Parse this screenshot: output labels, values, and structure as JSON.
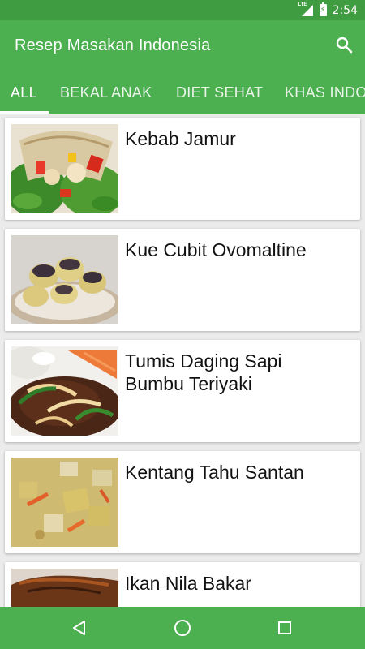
{
  "status_bar": {
    "time": "2:54",
    "network": "LTE"
  },
  "app_bar": {
    "title": "Resep Masakan Indonesia"
  },
  "tabs": [
    {
      "label": "ALL"
    },
    {
      "label": "BEKAL ANAK"
    },
    {
      "label": "DIET SEHAT"
    },
    {
      "label": "KHAS INDO"
    }
  ],
  "recipes": [
    {
      "title": "Kebab Jamur"
    },
    {
      "title": "Kue Cubit Ovomaltine"
    },
    {
      "title": "Tumis Daging Sapi Bumbu Teriyaki"
    },
    {
      "title": "Kentang Tahu Santan"
    },
    {
      "title": "Ikan Nila Bakar"
    }
  ],
  "colors": {
    "primary": "#4caf50",
    "primary_dark": "#3f9c40",
    "background": "#ebebeb"
  }
}
